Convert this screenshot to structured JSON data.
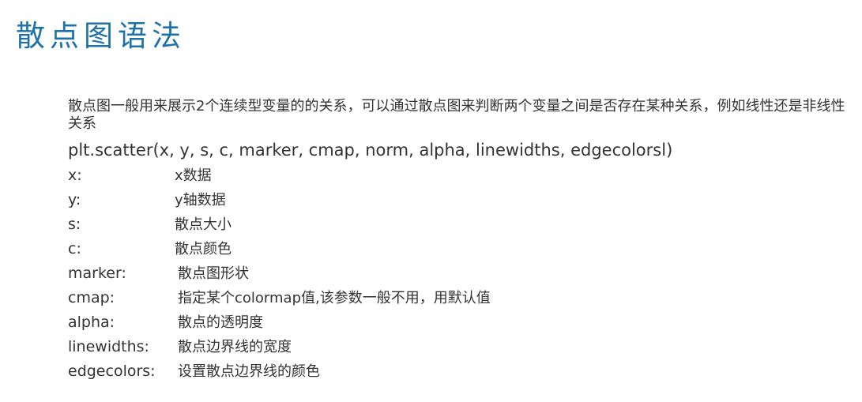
{
  "title": "散点图语法",
  "intro": "散点图一般用来展示2个连续型变量的的关系，可以通过散点图来判断两个变量之间是否存在某种关系，例如线性还是非线性关系",
  "signature": "plt.scatter(x, y, s, c, marker, cmap, norm, alpha, linewidths,  edgecolorsl)",
  "params": [
    {
      "name": "x:",
      "desc": "x数据"
    },
    {
      "name": "y:",
      "desc": "y轴数据"
    },
    {
      "name": "s:",
      "desc": "散点大小"
    },
    {
      "name": "c:",
      "desc": "散点颜色"
    },
    {
      "name": "marker:",
      "desc": "散点图形状"
    },
    {
      "name": "cmap:",
      "desc": "指定某个colormap值,该参数一般不用，用默认值"
    },
    {
      "name": "alpha:",
      "desc": "散点的透明度"
    },
    {
      "name": "linewidths:",
      "desc": "散点边界线的宽度"
    },
    {
      "name": "edgecolors:",
      "desc": "设置散点边界线的颜色"
    }
  ],
  "colors": {
    "title": "#1f72a8",
    "text": "#333333",
    "background": "#ffffff"
  }
}
